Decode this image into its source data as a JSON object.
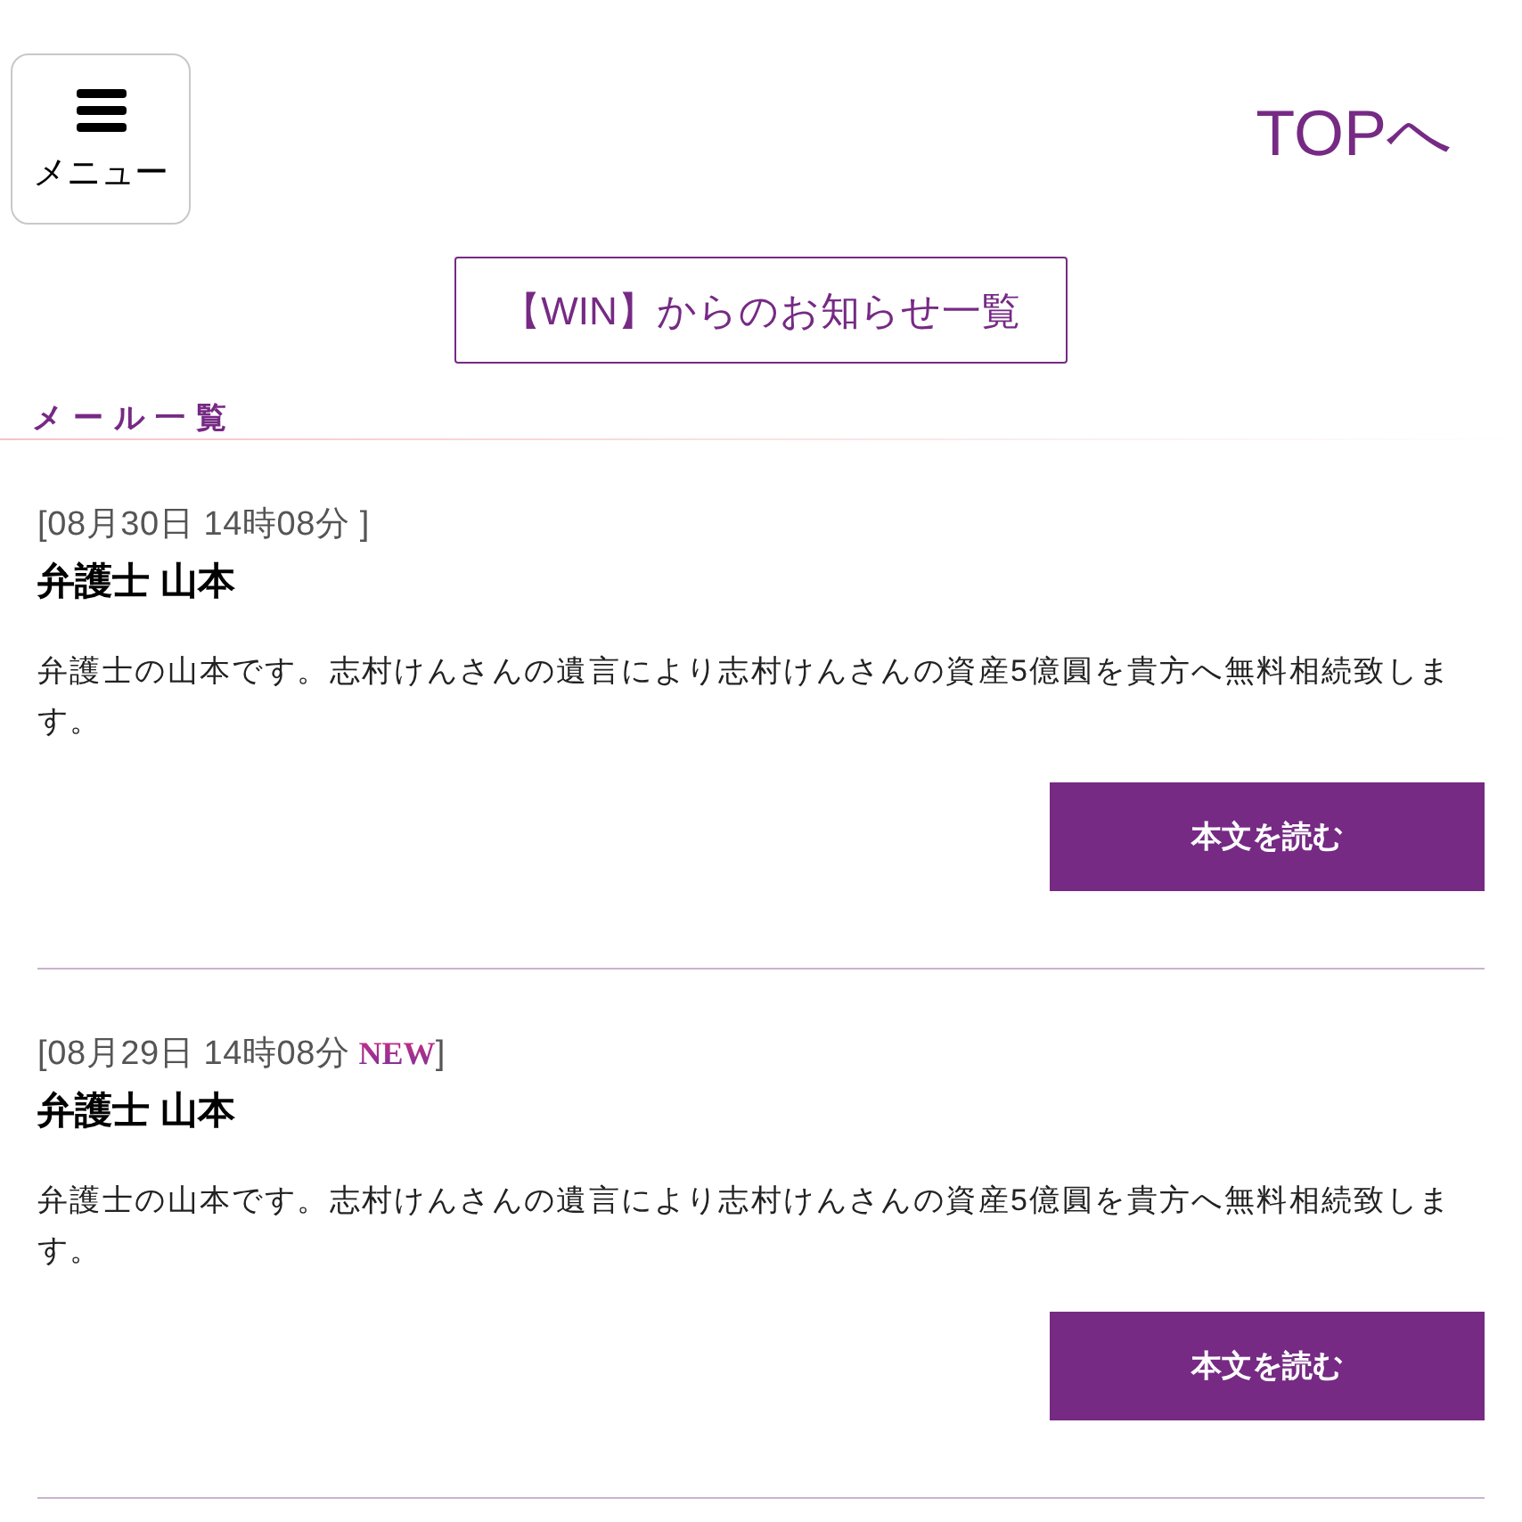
{
  "header": {
    "menu_button": {
      "label": "メニュー"
    },
    "top_link": {
      "label": "TOPへ"
    }
  },
  "notice_button": {
    "label": "【WIN】からのお知らせ一覧"
  },
  "section_title": "メール一覧",
  "messages": [
    {
      "date": "[08月30日 14時08分 ]",
      "sender": "弁護士 山本",
      "body": "弁護士の山本です。志村けんさんの遺言により志村けんさんの資産5億圓を貴方へ無料相続致します。",
      "button": "本文を読む"
    },
    {
      "date": "[08月29日 14時08分",
      "badge": "NEW",
      "date_end": "]",
      "sender": "弁護士 山本",
      "body": "弁護士の山本です。志村けんさんの遺言により志村けんさんの資産5億圓を貴方へ無料相続致します。",
      "button": "本文を読む"
    }
  ]
}
